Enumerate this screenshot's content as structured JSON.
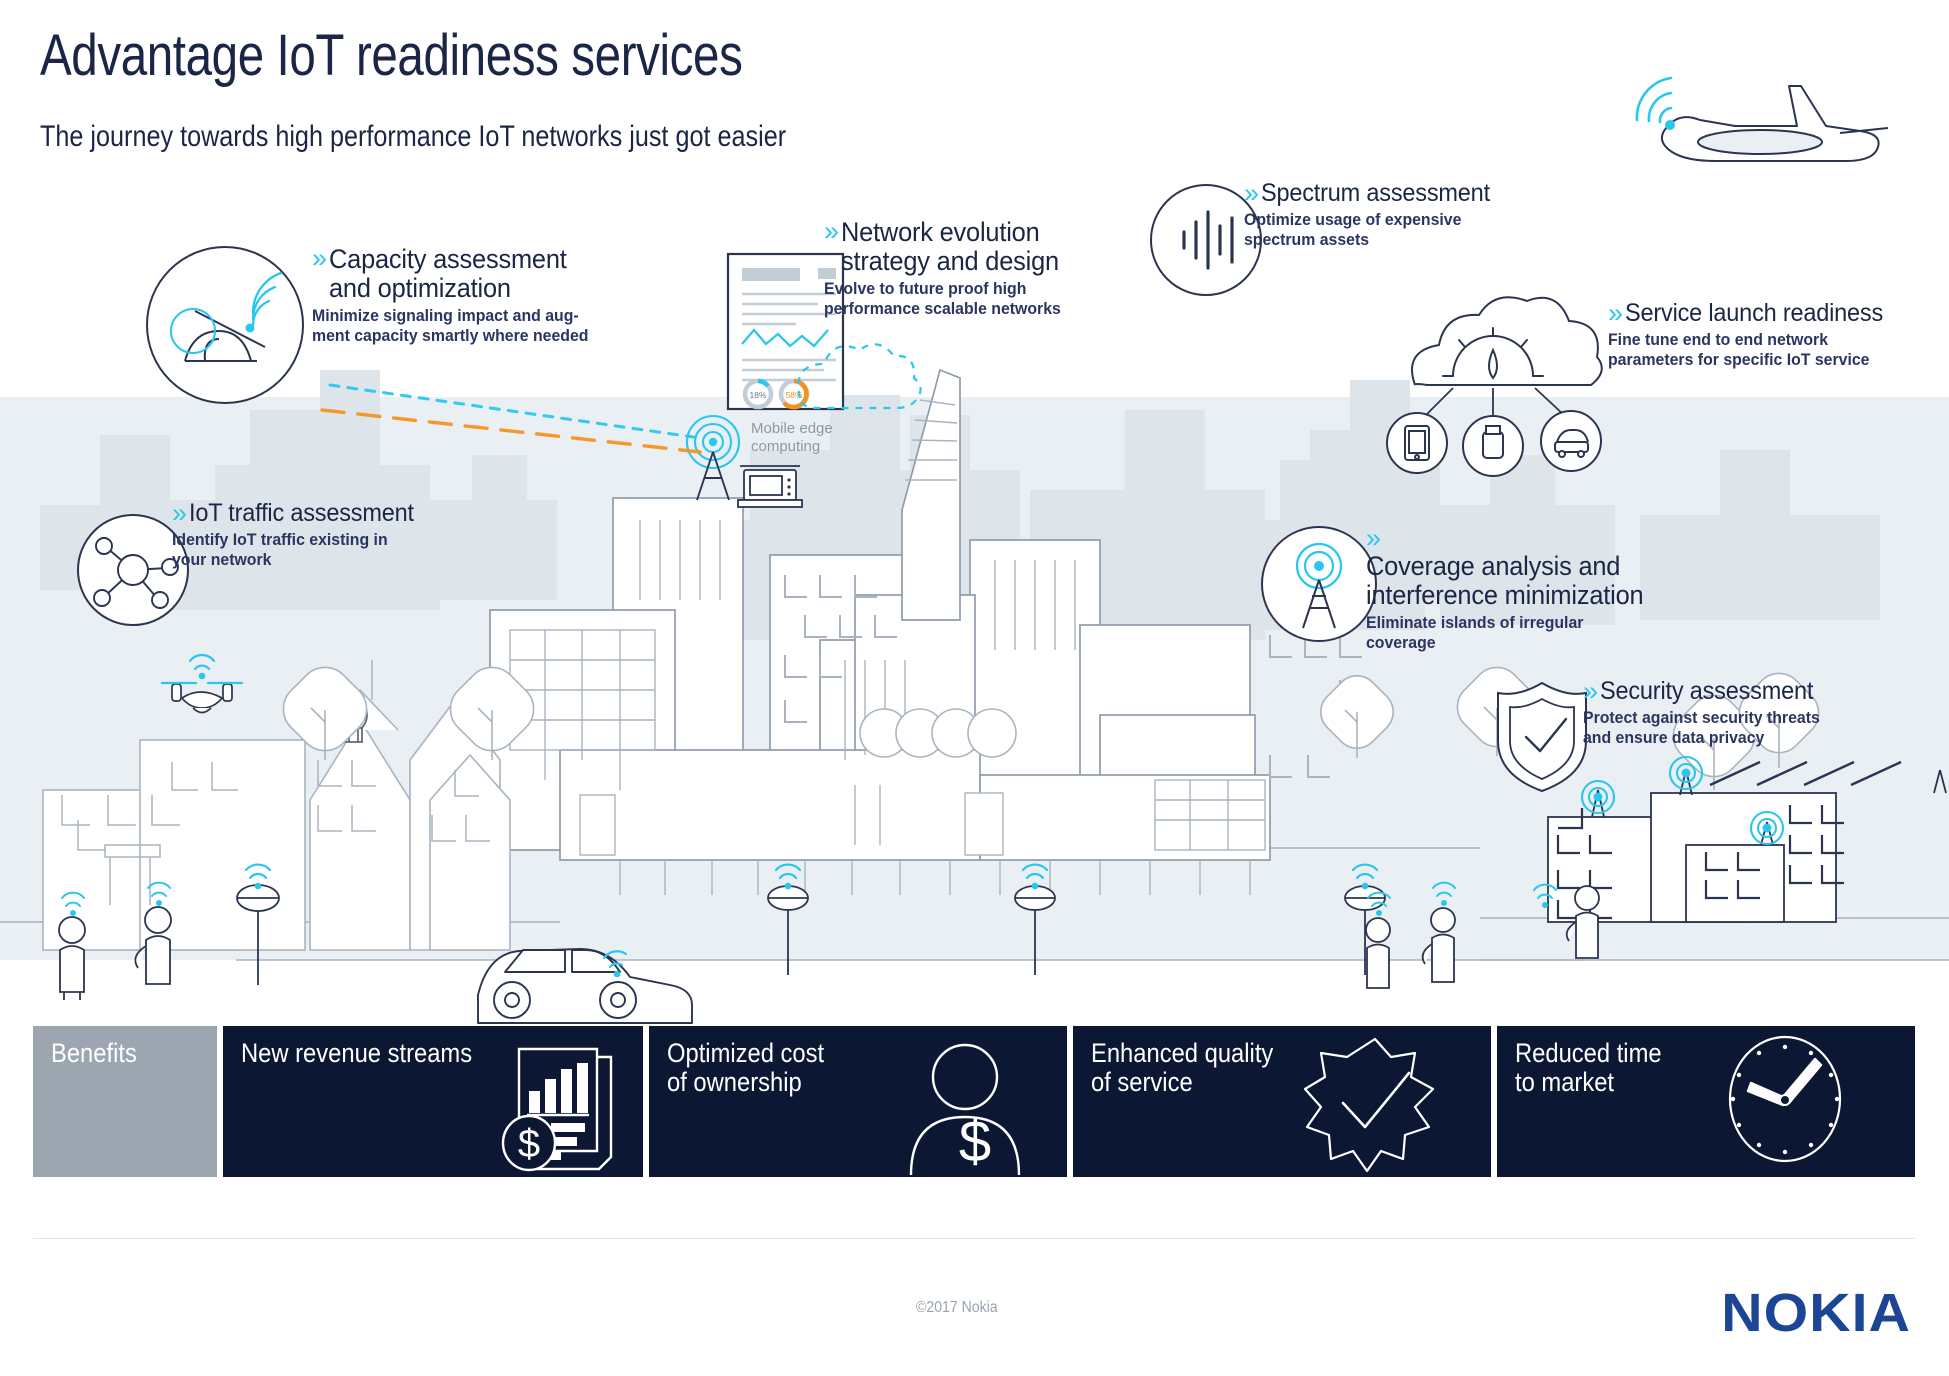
{
  "header": {
    "title": "Advantage IoT readiness services",
    "subtitle": "The journey towards high performance IoT networks just got easier"
  },
  "colors": {
    "navy": "#1b2545",
    "cyan": "#29c6ef",
    "orange": "#f5921e",
    "card_dark": "#0b1733",
    "card_grey": "#9ba6b1",
    "sky_band": "#e9eff3",
    "line_grey": "#a9b4c0",
    "nokia_blue": "#1c4595"
  },
  "callouts": [
    {
      "id": "capacity-assessment",
      "chevron": "»",
      "title": "Capacity assessment\nand optimization",
      "subtitle": "Minimize signaling impact and aug-\nment capacity smartly where needed",
      "icon": "car-signal-circle-icon"
    },
    {
      "id": "network-evolution",
      "chevron": "»",
      "title": "Network evolution\nstrategy and design",
      "subtitle": "Evolve to future proof high\nperformance scalable networks",
      "icon": "document-chart-cloud-icon"
    },
    {
      "id": "spectrum-assessment",
      "chevron": "»",
      "title": "Spectrum assessment",
      "subtitle": "Optimize usage of expensive\nspectrum assets",
      "icon": "spectrum-bars-circle-icon"
    },
    {
      "id": "service-launch-readiness",
      "chevron": "»",
      "title": "Service launch readiness",
      "subtitle": "Fine tune end to end network\nparameters for specific IoT service",
      "icon": "cloud-gauge-devices-icon"
    },
    {
      "id": "iot-traffic-assessment",
      "chevron": "»",
      "title": "IoT traffic assessment",
      "subtitle": "Identify IoT traffic existing in\nyour network",
      "icon": "network-nodes-circle-icon"
    },
    {
      "id": "coverage-analysis",
      "chevron": "»",
      "title": "Coverage analysis and\ninterference minimization",
      "subtitle": "Eliminate islands of irregular\ncoverage",
      "icon": "cell-tower-circle-icon"
    },
    {
      "id": "security-assessment",
      "chevron": "»",
      "title": "Security assessment",
      "subtitle": "Protect against security threats\nand ensure data privacy",
      "icon": "shield-check-icon"
    }
  ],
  "scene": {
    "mobile_edge_label": "Mobile edge\ncomputing",
    "document_donut_values": [
      "18%",
      "58%"
    ]
  },
  "benefits": {
    "header_label": "Benefits",
    "cards": [
      {
        "label": "New revenue streams",
        "icon": "bar-chart-dollar-icon"
      },
      {
        "label": "Optimized cost\nof ownership",
        "icon": "person-dollar-icon"
      },
      {
        "label": "Enhanced quality\nof service",
        "icon": "badge-check-icon"
      },
      {
        "label": "Reduced time\nto market",
        "icon": "clock-icon"
      }
    ]
  },
  "footer": {
    "copyright": "©2017 Nokia",
    "logo_text": "NOKIA"
  }
}
